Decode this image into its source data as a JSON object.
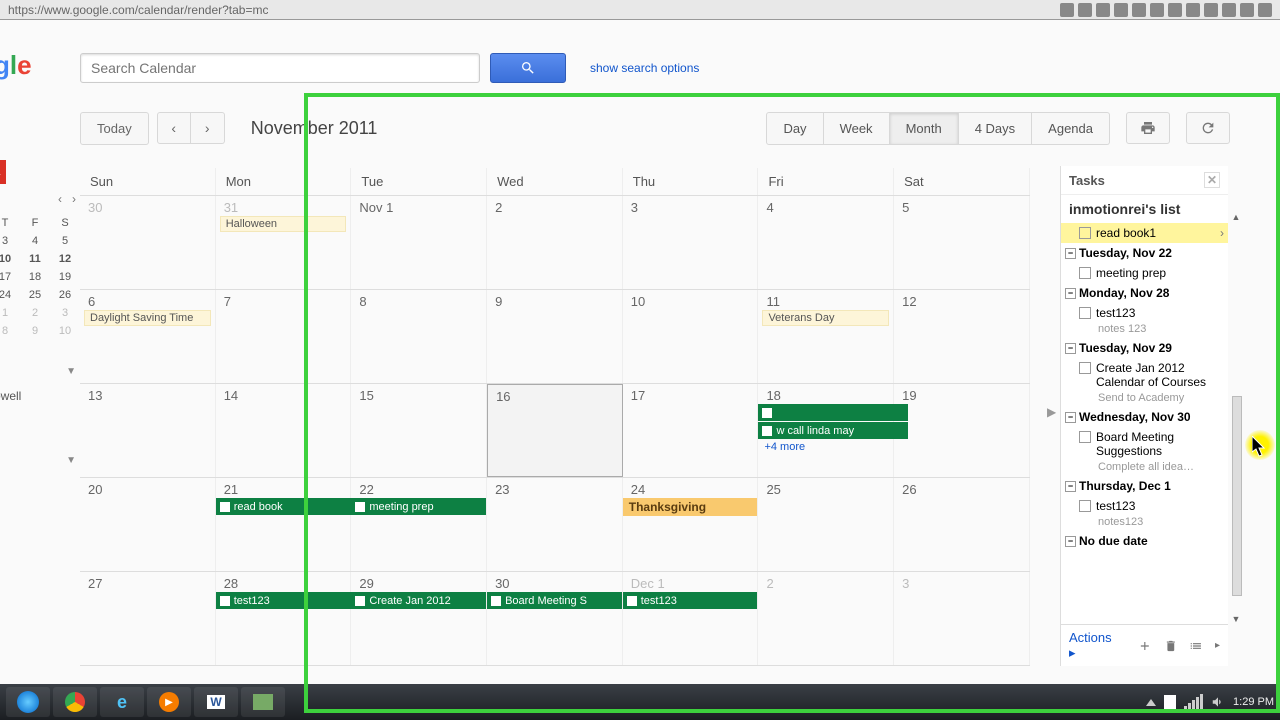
{
  "url": "https://www.google.com/calendar/render?tab=mc",
  "search": {
    "placeholder": "Search Calendar",
    "show_options": "show search options"
  },
  "toolbar": {
    "today": "Today",
    "month_label": "November 2011",
    "views": [
      "Day",
      "Week",
      "Month",
      "4 Days",
      "Agenda"
    ],
    "active_view": "Month"
  },
  "dow": [
    "Sun",
    "Mon",
    "Tue",
    "Wed",
    "Thu",
    "Fri",
    "Sat"
  ],
  "weeks": [
    [
      {
        "num": "30",
        "dim": true
      },
      {
        "num": "31",
        "dim": true,
        "allday": [
          "Halloween"
        ]
      },
      {
        "num": "Nov 1"
      },
      {
        "num": "2"
      },
      {
        "num": "3"
      },
      {
        "num": "4"
      },
      {
        "num": "5"
      }
    ],
    [
      {
        "num": "6",
        "allday": [
          "Daylight Saving Time"
        ]
      },
      {
        "num": "7"
      },
      {
        "num": "8"
      },
      {
        "num": "9"
      },
      {
        "num": "10"
      },
      {
        "num": "11",
        "allday": [
          "Veterans Day"
        ]
      },
      {
        "num": "12"
      }
    ],
    [
      {
        "num": "13"
      },
      {
        "num": "14"
      },
      {
        "num": "15"
      },
      {
        "num": "16",
        "today": true
      },
      {
        "num": "17"
      },
      {
        "num": "18",
        "green": [
          {
            "label": ""
          },
          {
            "label": "w call linda may"
          }
        ],
        "more": "+4 more",
        "span": true
      },
      {
        "num": "19"
      }
    ],
    [
      {
        "num": "20"
      },
      {
        "num": "21",
        "green": [
          {
            "label": "read book"
          }
        ],
        "span": true
      },
      {
        "num": "22",
        "green": [
          {
            "label": "meeting prep"
          }
        ]
      },
      {
        "num": "23"
      },
      {
        "num": "24",
        "holiday": "Thanksgiving"
      },
      {
        "num": "25"
      },
      {
        "num": "26"
      }
    ],
    [
      {
        "num": "27"
      },
      {
        "num": "28",
        "green": [
          {
            "label": "test123"
          }
        ],
        "span": true
      },
      {
        "num": "29",
        "green": [
          {
            "label": "Create Jan 2012"
          }
        ]
      },
      {
        "num": "30",
        "green": [
          {
            "label": "Board Meeting S"
          }
        ]
      },
      {
        "num": "Dec 1",
        "dim": true,
        "green": [
          {
            "label": "test123"
          }
        ]
      },
      {
        "num": "2",
        "dim": true
      },
      {
        "num": "3",
        "dim": true
      }
    ]
  ],
  "mini": {
    "dows": [
      "T",
      "F",
      "S"
    ],
    "rows": [
      [
        "3",
        "4",
        "5"
      ],
      [
        "10",
        "11",
        "12"
      ],
      [
        "17",
        "18",
        "19"
      ],
      [
        "24",
        "25",
        "26"
      ],
      [
        "1",
        "2",
        "3"
      ],
      [
        "8",
        "9",
        "10"
      ]
    ],
    "bold_row": 1,
    "dim_rows": [
      4,
      5
    ]
  },
  "left_items": [
    "owell"
  ],
  "tasks": {
    "title": "Tasks",
    "list_name": "inmotionrei's list",
    "groups": [
      {
        "selected": true,
        "items": [
          {
            "label": "read book1",
            "arrow": true
          }
        ]
      },
      {
        "date": "Tuesday, Nov 22",
        "items": [
          {
            "label": "meeting prep"
          }
        ]
      },
      {
        "date": "Monday, Nov 28",
        "items": [
          {
            "label": "test123",
            "sub": "notes 123"
          }
        ]
      },
      {
        "date": "Tuesday, Nov 29",
        "items": [
          {
            "label": "Create Jan 2012 Calendar of Courses",
            "sub": "Send to Academy"
          }
        ]
      },
      {
        "date": "Wednesday, Nov 30",
        "items": [
          {
            "label": "Board Meeting Suggestions",
            "sub": "Complete all idea…"
          }
        ]
      },
      {
        "date": "Thursday, Dec 1",
        "items": [
          {
            "label": "test123",
            "sub": "notes123"
          }
        ]
      },
      {
        "date": "No due date"
      }
    ],
    "actions": "Actions"
  },
  "taskbar": {
    "time": "1:29 PM"
  }
}
